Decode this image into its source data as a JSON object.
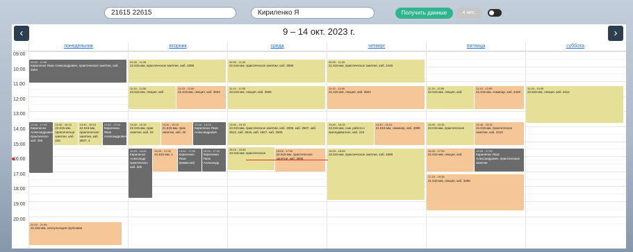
{
  "controls": {
    "group_value": "21615 22615",
    "teacher_value": "Кириленко Я",
    "get_button": "Получить данные",
    "months_button": "4 мес."
  },
  "calendar": {
    "title": "9 – 14 окт. 2023 г.",
    "prev_glyph": "‹",
    "next_glyph": "›",
    "days": [
      "понедельник",
      "вторник",
      "среда",
      "четверг",
      "пятница",
      "суббота"
    ],
    "hours": [
      "09:00",
      "10:00",
      "11:00",
      "12:00",
      "13:00",
      "14:00",
      "15:00",
      "16:00",
      "17:00",
      "18:00",
      "19:00",
      "20:00"
    ]
  },
  "events": [
    {
      "id": "mon-1",
      "time": "09:30 - 11:05",
      "text": "Кириленко Яков Александрович, практическое занятие, каб. 2504",
      "kind": "gray"
    },
    {
      "id": "mon-2",
      "time": "13:40 - 17:05",
      "text": "Кириленко Александрович практическо каб. 405",
      "kind": "gray"
    },
    {
      "id": "mon-3",
      "time": "13:40 - 15:15",
      "text": "22.615-мм, практическое занятие, каб. 316",
      "kind": "practice"
    },
    {
      "id": "mon-4",
      "time": "13:40 - 15:15",
      "text": "22.615-мм, практическое занятие, каб. 3507, 4",
      "kind": "practice"
    },
    {
      "id": "mon-5",
      "time": "13:40 - 15:15",
      "text": "Кириленко Яков Александрович",
      "kind": "gray"
    },
    {
      "id": "mon-6",
      "time": "20:20 - 21:55",
      "text": "21.615-мм, консультация групповая",
      "kind": "lecture"
    },
    {
      "id": "tue-1",
      "time": "09:30 - 11:05",
      "text": "22.615-мм, практическое занятие, каб. 3389",
      "kind": "practice"
    },
    {
      "id": "tue-2",
      "time": "11:15 - 12:50",
      "text": "22.615-мм, лекция, каб.",
      "kind": "practice"
    },
    {
      "id": "tue-3",
      "time": "11:15 - 12:50",
      "text": "21.615-мм, лекция, каб. 3504",
      "kind": "lecture"
    },
    {
      "id": "tue-4",
      "time": "13:40 - 15:15",
      "text": "22.615-мм, прак занятие, каб. 24",
      "kind": "practice"
    },
    {
      "id": "tue-5",
      "time": "13:40 - 15:15",
      "text": "21.615-мм, прак занятие, каб. 33",
      "kind": "lecture"
    },
    {
      "id": "tue-6",
      "time": "13:40 - 15:15",
      "text": "Кириленко Яков Александрович",
      "kind": "gray"
    },
    {
      "id": "tue-7",
      "time": "15:25 - 18:45",
      "text": "Кириленко Александр практическо каб. 405",
      "kind": "gray"
    },
    {
      "id": "tue-8",
      "time": "15:25 - 17:00",
      "text": "21.615-мм, 1",
      "kind": "lecture"
    },
    {
      "id": "tue-9",
      "time": "15:25 - 17:00",
      "text": "Кириленко Яков (комиссия)",
      "kind": "gray"
    },
    {
      "id": "tue-10",
      "time": "15:25 - 17:00",
      "text": "Кириленко Яков Александр",
      "kind": "gray"
    },
    {
      "id": "wed-1",
      "time": "09:30 - 11:05",
      "text": "22.615-мм, практическое занятие, каб. 3506",
      "kind": "practice"
    },
    {
      "id": "wed-2",
      "time": "11:15 - 12:50",
      "text": "22.615-мм, лекция, каб. 3506",
      "kind": "practice"
    },
    {
      "id": "wed-3",
      "time": "13:40 - 15:15",
      "text": "22.615-мм, практическое занятие, каб. 3505, каб. 3507, каб. 3512, каб. 3516, каб. 1507, каб. 2505",
      "kind": "practice"
    },
    {
      "id": "wed-4",
      "time": "15:20 - 16:55",
      "text": "22.615-мм, практическое",
      "kind": "practice"
    },
    {
      "id": "wed-5",
      "time": "15:25 - 17:00",
      "text": "22.615-мм, практическое занятие, каб. 3506",
      "kind": "lecture"
    },
    {
      "id": "thu-1",
      "time": "09:30 - 11:05",
      "text": "21.615-мм, практическое занятие, каб. 2448",
      "kind": "practice"
    },
    {
      "id": "thu-2",
      "time": "11:15 - 12:50",
      "text": "21.615-мм, лекция, каб. 3504",
      "kind": "lecture"
    },
    {
      "id": "thu-3",
      "time": "13:40 - 15:15",
      "text": "22.615-мм, сам. работа с преподавателя, каб. 244",
      "kind": "practice"
    },
    {
      "id": "thu-4",
      "time": "13:40 - 15:15",
      "text": "21.615-мм, семинар, каб. 3389",
      "kind": "lecture"
    },
    {
      "id": "thu-5",
      "time": "15:25 - 18:55",
      "text": "22.615-мм, практическое занятие, каб. 3389",
      "kind": "practice"
    },
    {
      "id": "fri-1",
      "time": "11:15 - 12:50",
      "text": "22.615-мм, лекция, каб.",
      "kind": "practice"
    },
    {
      "id": "fri-2",
      "time": "11:15 - 12:50",
      "text": "21.615-мм, семинар, каб. 2448",
      "kind": "lecture"
    },
    {
      "id": "fri-3",
      "time": "13:40 - 15:15",
      "text": "22.615-мм, практическое",
      "kind": "practice"
    },
    {
      "id": "fri-4",
      "time": "13:40 - 15:15",
      "text": "21.615-мм, практическое занятие, каб. 2410",
      "kind": "lecture"
    },
    {
      "id": "fri-5",
      "time": "15:25 - 17:00",
      "text": "21.615-мм, лекция, каб.",
      "kind": "lecture"
    },
    {
      "id": "fri-6",
      "time": "15:25 - 17:00",
      "text": "Кириленко Яков Александрович, практическое занятие",
      "kind": "gray"
    },
    {
      "id": "fri-7",
      "time": "17:10 - 19:35",
      "text": "21.615-мм, лекция, каб. 3389",
      "kind": "lecture"
    },
    {
      "id": "sat-1",
      "time": "11:15 - 13:45",
      "text": "22.615-мм, лекция, каб. 2412",
      "kind": "practice"
    }
  ]
}
